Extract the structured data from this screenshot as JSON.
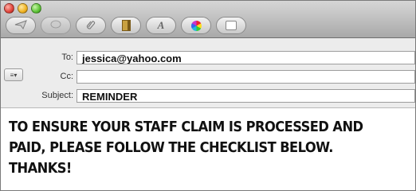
{
  "toolbar": {
    "buttons": [
      "send-icon",
      "chat-icon",
      "attach-icon",
      "address-book-icon",
      "fonts-icon",
      "colors-icon",
      "photo-browser-icon"
    ]
  },
  "header": {
    "to_label": "To:",
    "to_value": "jessica@yahoo.com",
    "cc_label": "Cc:",
    "cc_value": "",
    "subject_label": "Subject:",
    "subject_value": "REMINDER",
    "selector_label": "≡▾"
  },
  "body": {
    "line1": "TO ENSURE YOUR STAFF CLAIM IS PROCESSED AND",
    "line2": "PAID, PLEASE FOLLOW THE CHECKLIST BELOW.",
    "line3": "THANKS!"
  }
}
